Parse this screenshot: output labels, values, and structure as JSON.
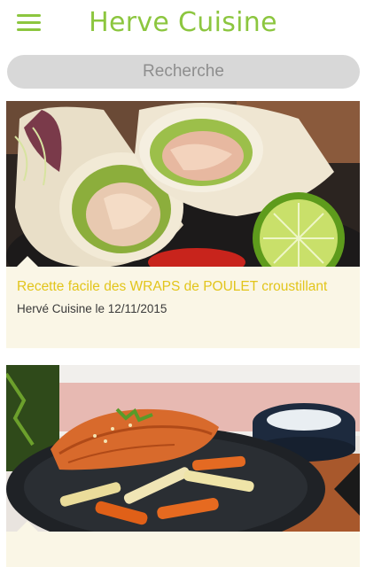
{
  "header": {
    "title": "Herve Cuisine",
    "menu_icon": "hamburger-menu-icon",
    "accent_color": "#8cc63f"
  },
  "search": {
    "placeholder": "Recherche"
  },
  "feed": {
    "items": [
      {
        "title": "Recette facile des WRAPS de POULET croustillant",
        "meta": "Hervé Cuisine le 12/11/2015",
        "image": "chicken-wraps-photo"
      },
      {
        "title": "",
        "meta": "",
        "image": "salmon-vegetables-photo"
      }
    ],
    "title_color": "#e2c51b",
    "caption_background": "#faf6e6"
  }
}
